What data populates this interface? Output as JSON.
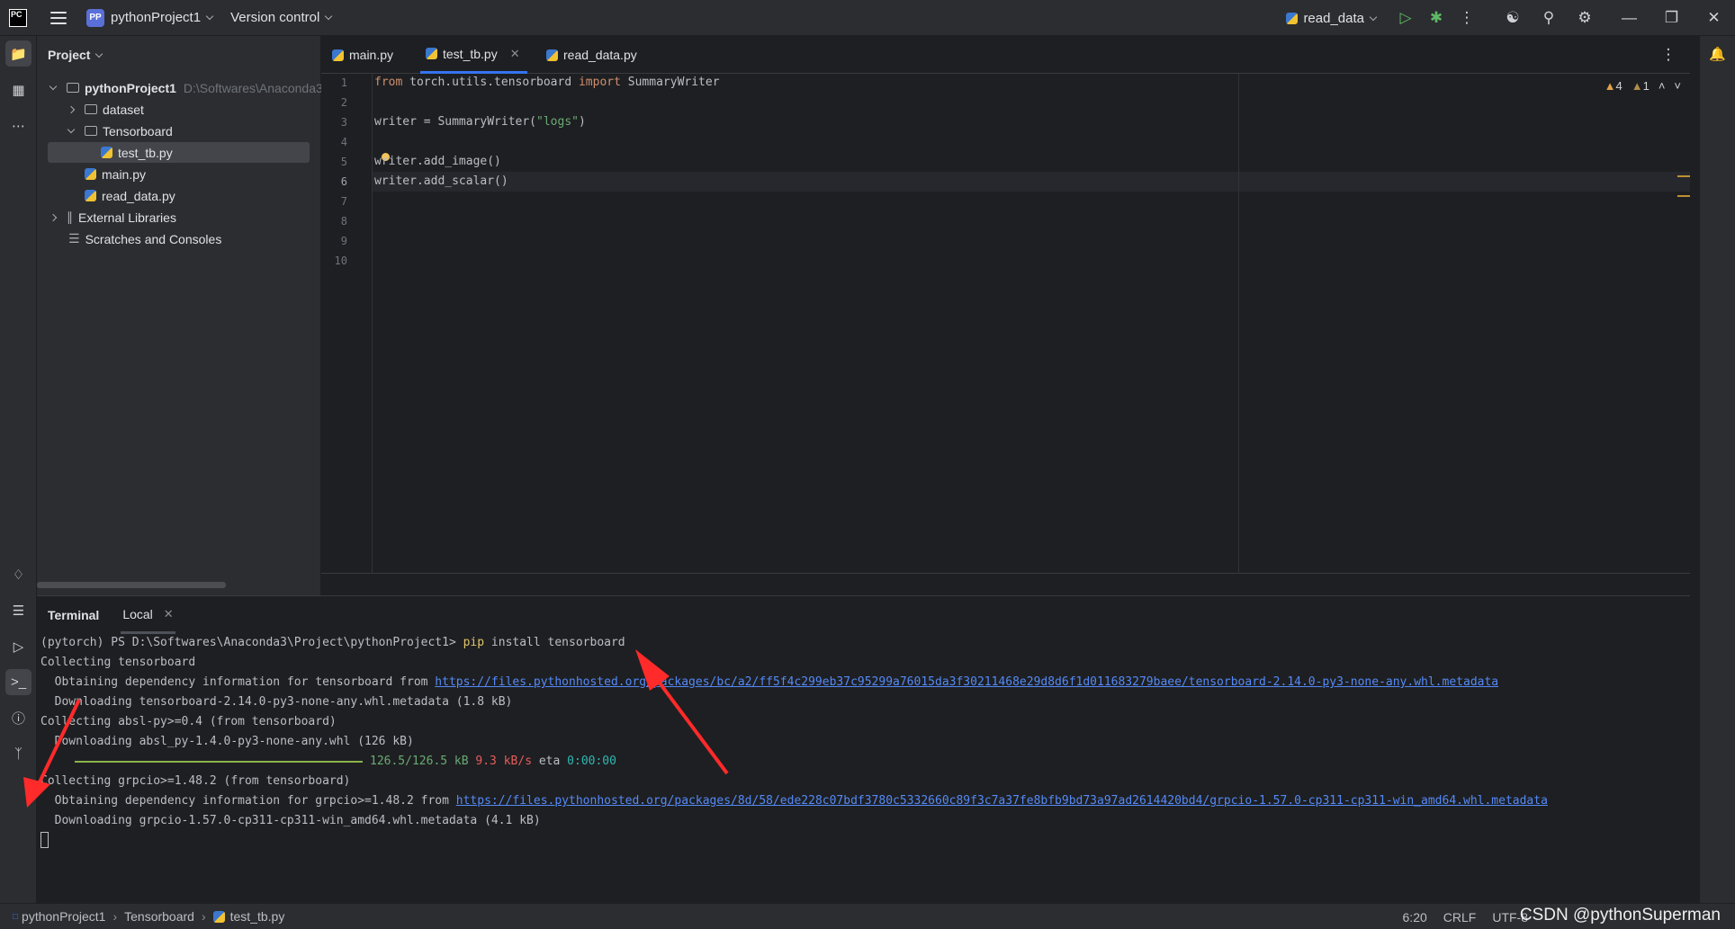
{
  "titlebar": {
    "logo": "PC",
    "project_badge": "PP",
    "project_name": "pythonProject1",
    "vcs": "Version control",
    "run_config": "read_data",
    "icons": [
      "run-icon",
      "debug-icon",
      "more-icon",
      "add-user-icon",
      "search-icon",
      "settings-icon",
      "minimize-icon",
      "maximize-icon",
      "close-icon"
    ]
  },
  "project_panel": {
    "title": "Project",
    "root_name": "pythonProject1",
    "root_path": "D:\\Softwares\\Anaconda3\\",
    "items": [
      {
        "label": "dataset"
      },
      {
        "label": "Tensorboard"
      },
      {
        "label": "test_tb.py"
      },
      {
        "label": "main.py"
      },
      {
        "label": "read_data.py"
      },
      {
        "label": "External Libraries"
      },
      {
        "label": "Scratches and Consoles"
      }
    ]
  },
  "editor": {
    "tabs": [
      {
        "label": "main.py"
      },
      {
        "label": "test_tb.py"
      },
      {
        "label": "read_data.py"
      }
    ],
    "inspections": {
      "warnings": "4",
      "weak_warnings": "1"
    },
    "line_numbers": [
      "1",
      "2",
      "3",
      "4",
      "5",
      "6",
      "7",
      "8",
      "9",
      "10"
    ],
    "lines": {
      "l1_kw1": "from",
      "l1_mid": " torch.utils.tensorboard ",
      "l1_kw2": "import",
      "l1_end": " SummaryWriter",
      "l3_pre": "writer = SummaryWriter(",
      "l3_str": "\"logs\"",
      "l3_post": ")",
      "l5": "writer.add_image()",
      "l6": "writer.add_scalar()"
    }
  },
  "terminal": {
    "title": "Terminal",
    "tab": "Local",
    "lines": {
      "prompt": "(pytorch) PS D:\\Softwares\\Anaconda3\\Project\\pythonProject1> ",
      "cmd_pip": "pip",
      "cmd_rest": " install tensorboard",
      "l2": "Collecting tensorboard",
      "l3_pre": "  Obtaining dependency information for tensorboard from ",
      "l3_link": "https://files.pythonhosted.org/packages/bc/a2/ff5f4c299eb37c95299a76015da3f30211468e29d8d6f1d011683279baee/tensorboard-2.14.0-py3-none-any.whl.metadata",
      "l4": "  Downloading tensorboard-2.14.0-py3-none-any.whl.metadata (1.8 kB)",
      "l5": "Collecting absl-py>=0.4 (from tensorboard)",
      "l6": "  Downloading absl_py-1.4.0-py3-none-any.whl (126 kB)",
      "l7_size": "126.5/126.5 kB",
      "l7_speed": "9.3 kB/s",
      "l7_eta_label": "eta",
      "l7_eta": "0:00:00",
      "l8": "Collecting grpcio>=1.48.2 (from tensorboard)",
      "l9_pre": "  Obtaining dependency information for grpcio>=1.48.2 from ",
      "l9_link": "https://files.pythonhosted.org/packages/8d/58/ede228c07bdf3780c5332660c89f3c7a37fe8bfb9bd73a97ad2614420bd4/grpcio-1.57.0-cp311-cp311-win_amd64.whl.metadata",
      "l10": "  Downloading grpcio-1.57.0-cp311-cp311-win_amd64.whl.metadata (4.1 kB)"
    },
    "progress": 1.0
  },
  "statusbar": {
    "crumbs": [
      "pythonProject1",
      "Tensorboard",
      "test_tb.py"
    ],
    "position": "6:20",
    "line_sep": "CRLF",
    "encoding": "UTF-8",
    "watermark": "CSDN @pythonSuperman"
  },
  "colors": {
    "accent": "#3574f0",
    "annotation_arrow": "#ff2a2a"
  }
}
